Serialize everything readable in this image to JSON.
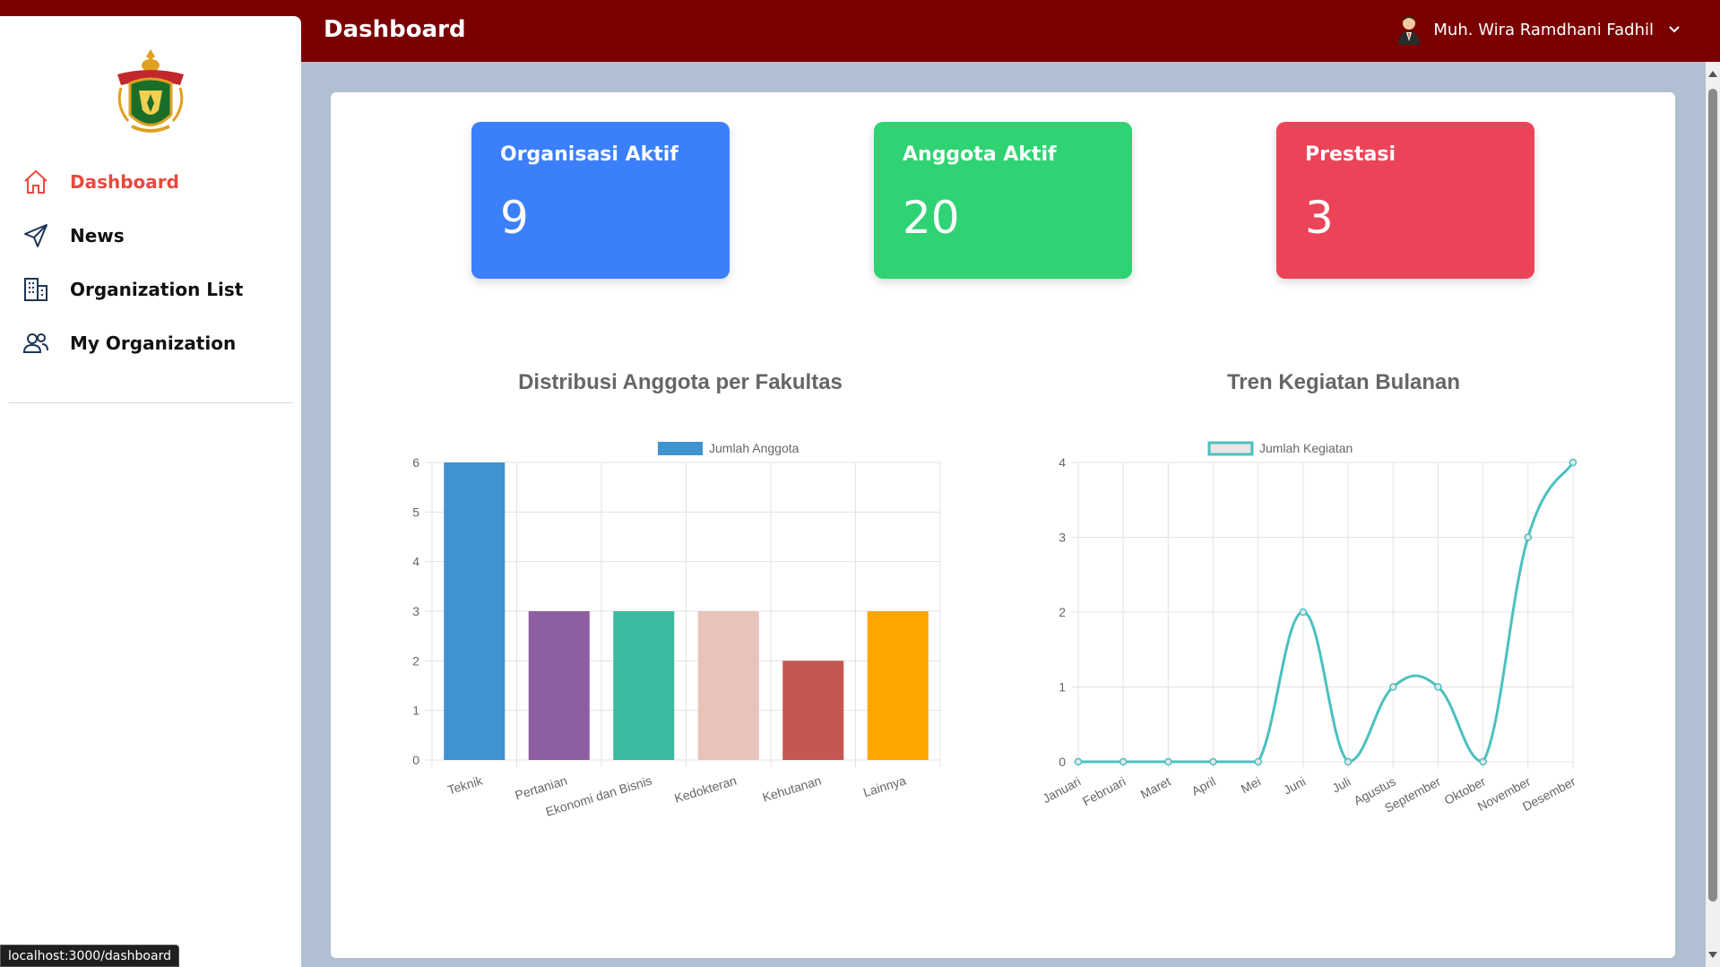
{
  "header": {
    "title": "Dashboard",
    "user_name": "Muh. Wira Ramdhani Fadhil"
  },
  "sidebar": {
    "items": [
      {
        "label": "Dashboard",
        "icon": "home-icon",
        "active": true
      },
      {
        "label": "News",
        "icon": "send-icon",
        "active": false
      },
      {
        "label": "Organization List",
        "icon": "building-icon",
        "active": false
      },
      {
        "label": "My Organization",
        "icon": "users-icon",
        "active": false
      }
    ]
  },
  "stats": [
    {
      "label": "Organisasi Aktif",
      "value": "9",
      "color": "#3b7ffb"
    },
    {
      "label": "Anggota Aktif",
      "value": "20",
      "color": "#2fd373"
    },
    {
      "label": "Prestasi",
      "value": "3",
      "color": "#eb4459"
    }
  ],
  "status_bar": {
    "url": "localhost:3000/dashboard"
  },
  "chart_data": [
    {
      "type": "bar",
      "title": "Distribusi Anggota per Fakultas",
      "categories": [
        "Teknik",
        "Pertanian",
        "Ekonomi dan Bisnis",
        "Kedokteran",
        "Kehutanan",
        "Lainnya"
      ],
      "series": [
        {
          "name": "Jumlah Anggota",
          "values": [
            6,
            3,
            3,
            3,
            2,
            3
          ]
        }
      ],
      "colors": [
        "#3f93cf",
        "#8e5ea2",
        "#3cba9f",
        "#e8c3b9",
        "#c45850",
        "#ffa500"
      ],
      "legend_color": "#3f93cf",
      "ylim": [
        0,
        6
      ],
      "yticks": [
        0,
        1,
        2,
        3,
        4,
        5,
        6
      ],
      "legend": "top",
      "grid": true
    },
    {
      "type": "line",
      "title": "Tren Kegiatan Bulanan",
      "categories": [
        "Januari",
        "Februari",
        "Maret",
        "April",
        "Mei",
        "Juni",
        "Juli",
        "Agustus",
        "September",
        "Oktober",
        "November",
        "Desember"
      ],
      "series": [
        {
          "name": "Jumlah Kegiatan",
          "values": [
            0,
            0,
            0,
            0,
            0,
            2,
            0,
            1,
            1,
            0,
            3,
            4
          ]
        }
      ],
      "line_color": "#4bc0c0",
      "ylim": [
        0,
        4
      ],
      "yticks": [
        0,
        1,
        2,
        3,
        4
      ],
      "legend": "top",
      "grid": true
    }
  ]
}
